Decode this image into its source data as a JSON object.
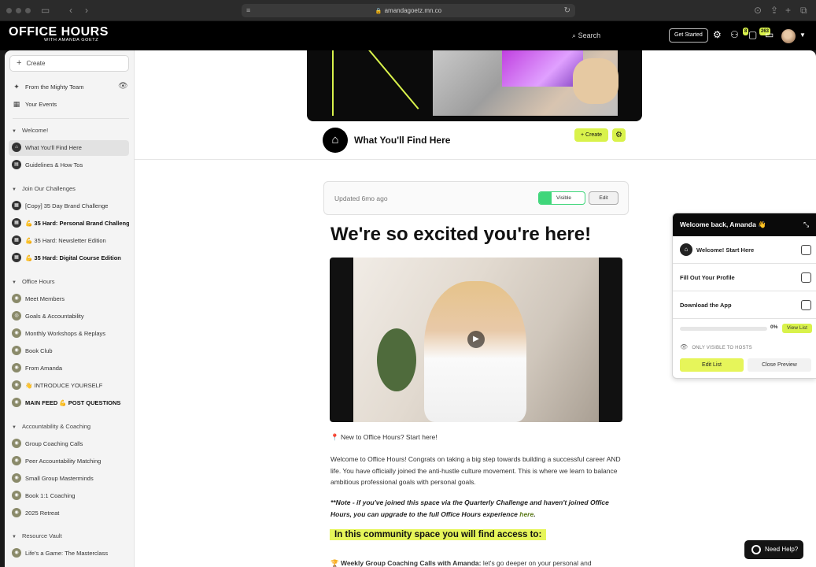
{
  "browser": {
    "url": "amandagoetz.mn.co"
  },
  "header": {
    "logo_title": "OFFICE HOURS",
    "logo_subtitle": "WITH AMANDA GOETZ",
    "search_label": "Search",
    "get_started_label": "Get Started",
    "people_badge": "8",
    "chat_badge": "263"
  },
  "sidebar": {
    "create_label": "Create",
    "top_items": [
      {
        "label": "From the Mighty Team",
        "icon": "sparkle-icon"
      },
      {
        "label": "Your Events",
        "icon": "calendar-icon"
      }
    ],
    "sections": [
      {
        "title": "Welcome!",
        "items": [
          {
            "label": "What You'll Find Here",
            "active": true,
            "bold": false
          },
          {
            "label": "Guidelines & How Tos",
            "active": false,
            "bold": false
          }
        ]
      },
      {
        "title": "Join Our Challenges",
        "items": [
          {
            "label": "[Copy] 35 Day Brand Challenge",
            "bold": false
          },
          {
            "label": "💪 35 Hard: Personal Brand Challenge",
            "bold": true
          },
          {
            "label": "💪 35 Hard: Newsletter Edition",
            "bold": false
          },
          {
            "label": "💪 35 Hard: Digital Course Edition",
            "bold": true
          }
        ]
      },
      {
        "title": "Office Hours",
        "items": [
          {
            "label": "Meet Members",
            "bold": false
          },
          {
            "label": "Goals & Accountability",
            "bold": false
          },
          {
            "label": "Monthly Workshops & Replays",
            "bold": false
          },
          {
            "label": "Book Club",
            "bold": false
          },
          {
            "label": "From Amanda",
            "bold": false
          },
          {
            "label": "👋 INTRODUCE YOURSELF",
            "bold": false
          },
          {
            "label": "MAIN FEED 💪 POST QUESTIONS",
            "bold": true
          }
        ]
      },
      {
        "title": "Accountability & Coaching",
        "items": [
          {
            "label": "Group Coaching Calls",
            "bold": false
          },
          {
            "label": "Peer Accountability Matching",
            "bold": false
          },
          {
            "label": "Small Group Masterminds",
            "bold": false
          },
          {
            "label": "Book 1:1 Coaching",
            "bold": false
          },
          {
            "label": "2025 Retreat",
            "bold": false
          }
        ]
      },
      {
        "title": "Resource Vault",
        "items": [
          {
            "label": "Life's a Game: The Masterclass",
            "bold": false
          }
        ]
      }
    ]
  },
  "main": {
    "space_title": "What You'll Find Here",
    "create_label": "Create",
    "updated_text": "Updated 6mo ago",
    "visible_label": "Visible",
    "edit_label": "Edit",
    "heading": "We're so excited you're here!",
    "intro_line": "📍 New to Office Hours? Start here!",
    "paragraph1": "Welcome to Office Hours! Congrats on taking a big step towards building a successful career AND life. You have officially joined the anti-hustle culture movement. This is where we learn to balance ambitious professional goals with personal goals.",
    "note_text": "**Note - if you've joined this space via the Quarterly Challenge and haven't joined Office Hours, you can upgrade to the full Office Hours experience ",
    "note_link": "here",
    "note_end": ".",
    "highlight": "In this community space you will find access to:",
    "last_line_bold": "🏆 Weekly Group Coaching Calls with Amanda:",
    "last_line_rest": " let's go deeper on your personal and"
  },
  "onboarding": {
    "title": "Welcome back, Amanda 👋",
    "items": [
      {
        "label": "Welcome! Start Here",
        "has_icon": true
      },
      {
        "label": "Fill Out Your Profile",
        "has_icon": false
      },
      {
        "label": "Download the App",
        "has_icon": false
      }
    ],
    "progress_percent": 0,
    "progress_label": "0%",
    "view_list_label": "View List",
    "hosts_note": "ONLY VISIBLE TO HOSTS",
    "edit_list_label": "Edit List",
    "close_preview_label": "Close Preview"
  },
  "help": {
    "label": "Need Help?"
  },
  "colors": {
    "accent": "#d9f24b",
    "toggle_green": "#3fd67a"
  }
}
